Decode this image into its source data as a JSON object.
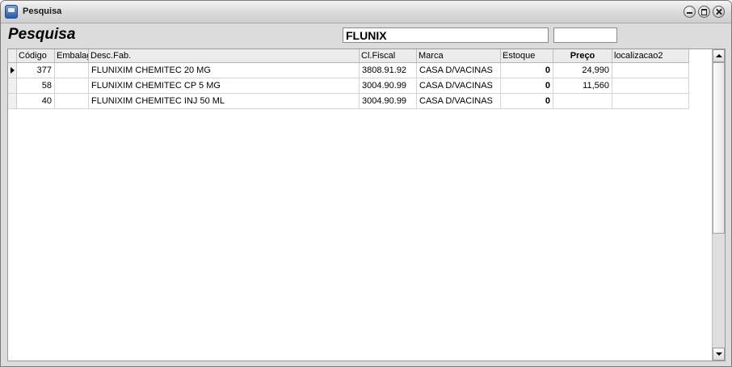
{
  "window": {
    "title": "Pesquisa",
    "icon": "app-icon"
  },
  "toolbar": {
    "heading": "Pesquisa",
    "search_value": "FLUNIX",
    "aux_value": ""
  },
  "grid": {
    "columns": [
      {
        "label": "Código"
      },
      {
        "label": "Embalagem"
      },
      {
        "label": "Desc.Fab."
      },
      {
        "label": "Cl.Fiscal"
      },
      {
        "label": "Marca"
      },
      {
        "label": "Estoque"
      },
      {
        "label": "Preço"
      },
      {
        "label": "localizacao2"
      }
    ],
    "rows": [
      {
        "codigo": "377",
        "embalagem": "",
        "desc": "FLUNIXIM CHEMITEC 20 MG",
        "clfiscal": "3808.91.92",
        "marca": "CASA D/VACINAS",
        "estoque": "0",
        "preco": "24,990",
        "localizacao": ""
      },
      {
        "codigo": "58",
        "embalagem": "",
        "desc": "FLUNIXIM CHEMITEC CP 5 MG",
        "clfiscal": "3004.90.99",
        "marca": "CASA D/VACINAS",
        "estoque": "0",
        "preco": "11,560",
        "localizacao": ""
      },
      {
        "codigo": "40",
        "embalagem": "",
        "desc": "FLUNIXIM CHEMITEC INJ 50 ML",
        "clfiscal": "3004.90.99",
        "marca": "CASA D/VACINAS",
        "estoque": "0",
        "preco": "",
        "localizacao": ""
      }
    ],
    "current_row": 0
  }
}
